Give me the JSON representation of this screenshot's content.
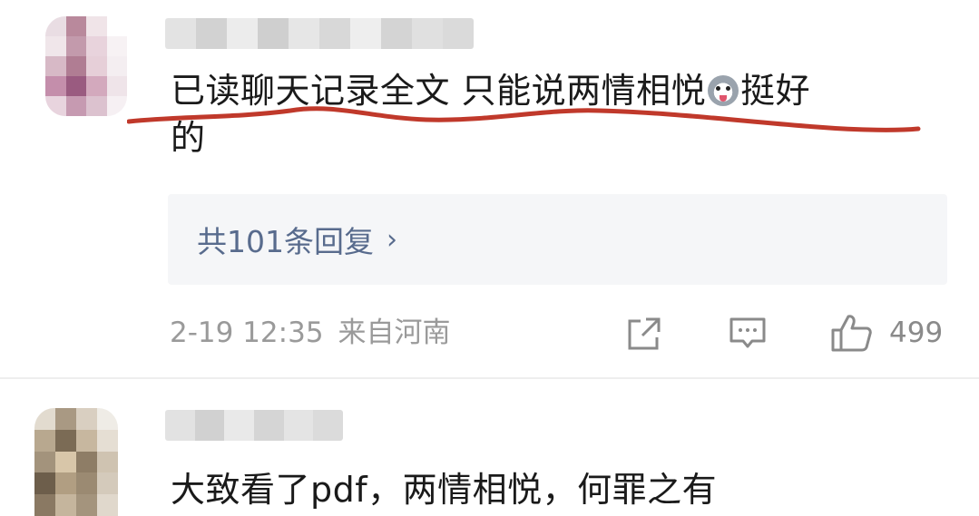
{
  "comments": [
    {
      "text_part1": "已读聊天记录全文 只能说两情相悦",
      "emoji": "dog-emoji",
      "text_part2": "挺好",
      "text_line2": "的",
      "replies_label": "共101条回复",
      "replies_chevron": "›",
      "timestamp": "2-19 12:35",
      "location": "来自河南",
      "like_count": "499"
    },
    {
      "text": "大致看了pdf，两情相悦，何罪之有"
    }
  ],
  "icons": {
    "share": "share-icon",
    "comment": "comment-icon",
    "like": "thumbs-up-icon"
  },
  "colors": {
    "reply_link": "#586b8d",
    "meta_text": "#9a9a9a",
    "underline": "#c0392b",
    "replies_bg": "#f5f6f8"
  }
}
